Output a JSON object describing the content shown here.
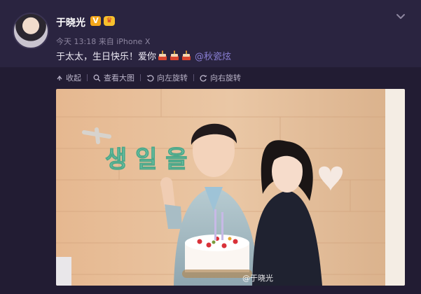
{
  "post": {
    "user_name": "于晓光",
    "badge_v": "V",
    "meta": "今天 13:18 来自 iPhone X",
    "text_before": "于太太，生日快乐！爱你",
    "cakes": [
      "cake-emoji",
      "cake-emoji",
      "cake-emoji"
    ],
    "mention": "@秋瓷炫"
  },
  "toolbar": {
    "collapse": "收起",
    "view_large": "查看大图",
    "rotate_left": "向左旋转",
    "rotate_right": "向右旋转"
  },
  "photo": {
    "banner_text": "생 일 을",
    "watermark": "@于晓光"
  },
  "colors": {
    "background": "#221c33",
    "header": "#2a2440",
    "mention": "#8a7fd4",
    "vip_badge": "#f2a61a"
  }
}
